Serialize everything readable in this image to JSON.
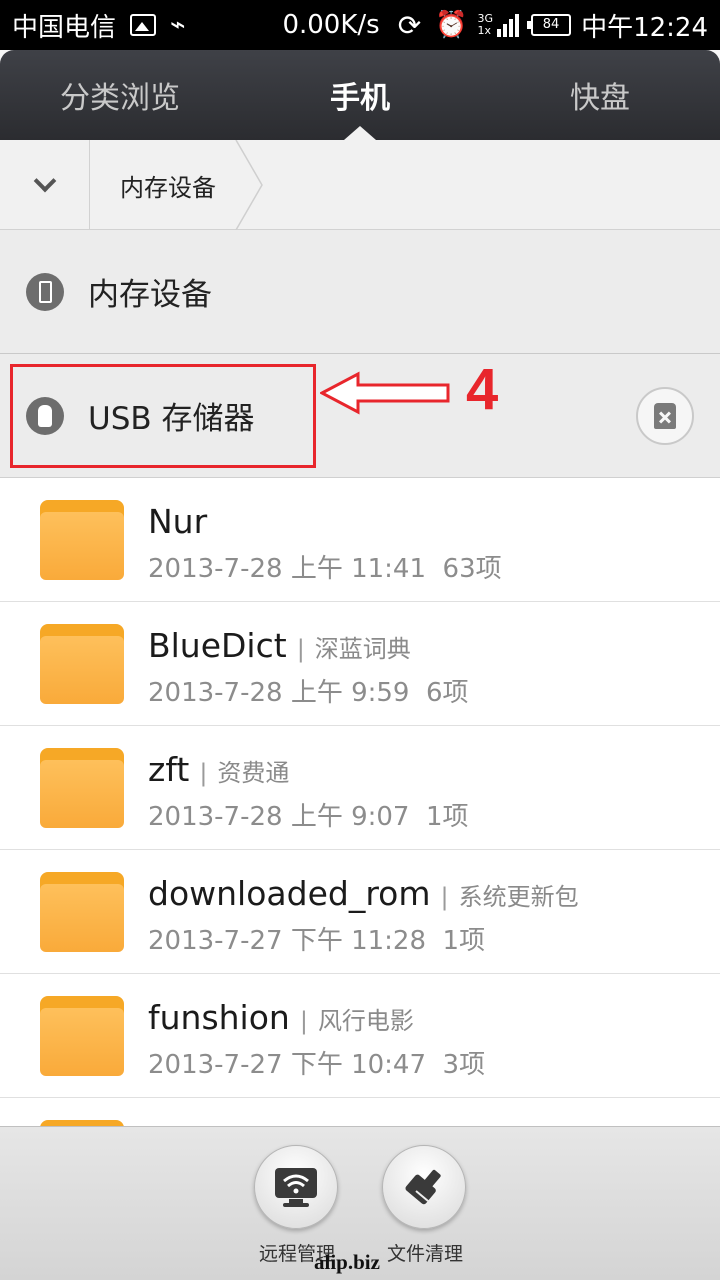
{
  "status_bar": {
    "carrier": "中国电信",
    "speed": "0.00K/s",
    "network_top": "3G",
    "network_bottom": "1x",
    "battery": "84",
    "time": "中午12:24"
  },
  "tabs": [
    {
      "label": "分类浏览",
      "active": false
    },
    {
      "label": "手机",
      "active": true
    },
    {
      "label": "快盘",
      "active": false
    }
  ],
  "breadcrumb": {
    "current": "内存设备"
  },
  "storage": {
    "internal_label": "内存设备",
    "usb_label": "USB 存储器"
  },
  "annotation": {
    "number": "4",
    "color": "#e8262c"
  },
  "files": [
    {
      "name": "Nur",
      "desc": "",
      "date": "2013-7-28 上午 11:41",
      "count": "63项"
    },
    {
      "name": "BlueDict",
      "desc": "深蓝词典",
      "date": "2013-7-28 上午 9:59",
      "count": "6项"
    },
    {
      "name": "zft",
      "desc": "资费通",
      "date": "2013-7-28 上午 9:07",
      "count": "1项"
    },
    {
      "name": "downloaded_rom",
      "desc": "系统更新包",
      "date": "2013-7-27 下午 11:28",
      "count": "1项"
    },
    {
      "name": "funshion",
      "desc": "风行电影",
      "date": "2013-7-27 下午 10:47",
      "count": "3项"
    }
  ],
  "bottom_bar": {
    "remote_label": "远程管理",
    "clean_label": "文件清理"
  },
  "watermark": "alip.biz",
  "colors": {
    "folder": "#f9aa3a",
    "tab_bg": "#2b2c30"
  }
}
